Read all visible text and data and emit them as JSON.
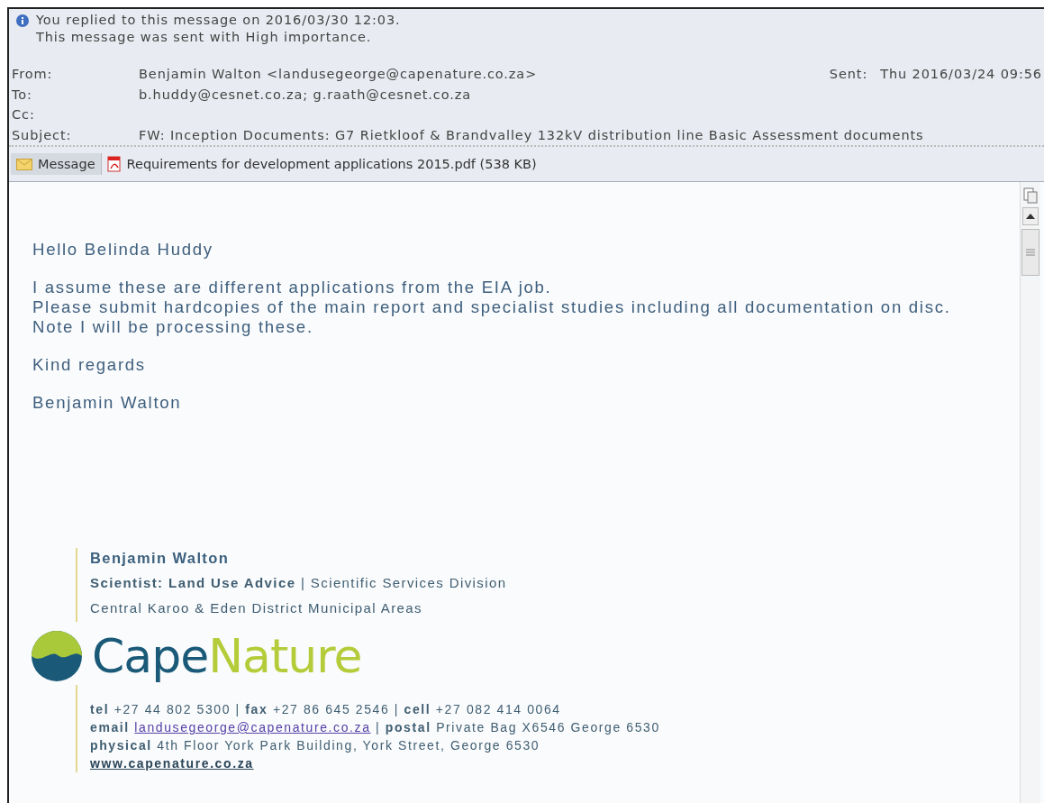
{
  "info_bar": {
    "lines": [
      "You replied to this message on 2016/03/30 12:03.",
      "This message was sent with High importance."
    ]
  },
  "header": {
    "fields": [
      {
        "label": "From:",
        "value": "Benjamin Walton <landusegeorge@capenature.co.za>"
      },
      {
        "label": "To:",
        "value": "b.huddy@cesnet.co.za; g.raath@cesnet.co.za"
      },
      {
        "label": "Cc:"
      },
      {
        "label": "Subject:",
        "value": "FW: Inception Documents: G7 Rietkloof & Brandvalley 132kV distribution line Basic Assessment documents"
      }
    ],
    "sent": {
      "label": "Sent:",
      "value": "Thu 2016/03/24 09:56"
    }
  },
  "tabs": [
    {
      "kind": "message",
      "label": "Message",
      "selected": true
    },
    {
      "kind": "attachment",
      "label": "Requirements for development applications 2015.pdf (538 KB)",
      "selected": false
    }
  ],
  "body": {
    "paragraphs": [
      [
        "Hello Belinda Huddy"
      ],
      [
        "I assume these are different applications from the EIA job.",
        "Please submit hardcopies of the main report and specialist studies including all documentation on disc.",
        "Note I will be processing these."
      ],
      [
        "Kind regards"
      ],
      [
        "Benjamin Walton"
      ]
    ],
    "signature": {
      "name": "Benjamin Walton",
      "title": "**Scientist: Land Use Advice** | Scientific Services Division",
      "area": "Central Karoo & Eden District Municipal Areas",
      "logo": {
        "first": "Cape",
        "second": "Nature"
      },
      "contacts": [
        {
          "text": "**tel** +27 44 802 5300 | **fax** +27 86 645 2546 | **cell** +27 082 414 0064"
        },
        {
          "text": "**email**",
          "link": "landusegeorge@capenature.co.za",
          "after": "| **postal** Private Bag X6546 George 6530"
        },
        {
          "text": "**physical** 4th Floor York Park Building, York Street, George 6530"
        }
      ],
      "website": "www.capenature.co.za"
    }
  }
}
